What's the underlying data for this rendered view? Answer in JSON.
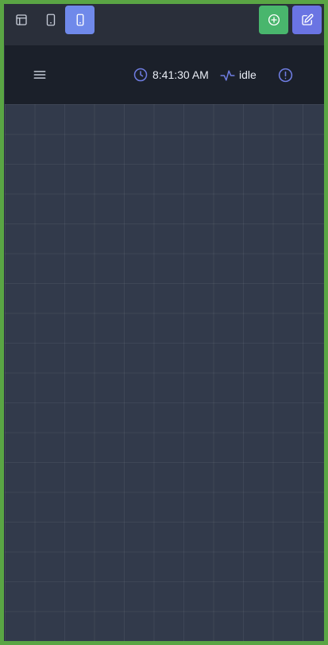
{
  "toolbar": {
    "buttons": [
      {
        "name": "layout",
        "icon": "layout-icon",
        "selected": false
      },
      {
        "name": "tablet",
        "icon": "tablet-icon",
        "selected": false
      },
      {
        "name": "mobile",
        "icon": "mobile-icon",
        "selected": true
      },
      {
        "name": "add",
        "icon": "plus-circle-icon",
        "color": "#49b66d"
      },
      {
        "name": "edit",
        "icon": "edit-icon",
        "color": "#6a74e3"
      }
    ],
    "accent_color": "#6f89ea"
  },
  "header": {
    "menu_icon": "hamburger-menu-icon",
    "time": "8:41:30 AM",
    "status": "idle",
    "clock_icon": "clock-icon",
    "activity_icon": "activity-icon",
    "alert_icon": "alert-circle-icon"
  },
  "canvas": {
    "background": "#323a4b",
    "grid": true
  }
}
